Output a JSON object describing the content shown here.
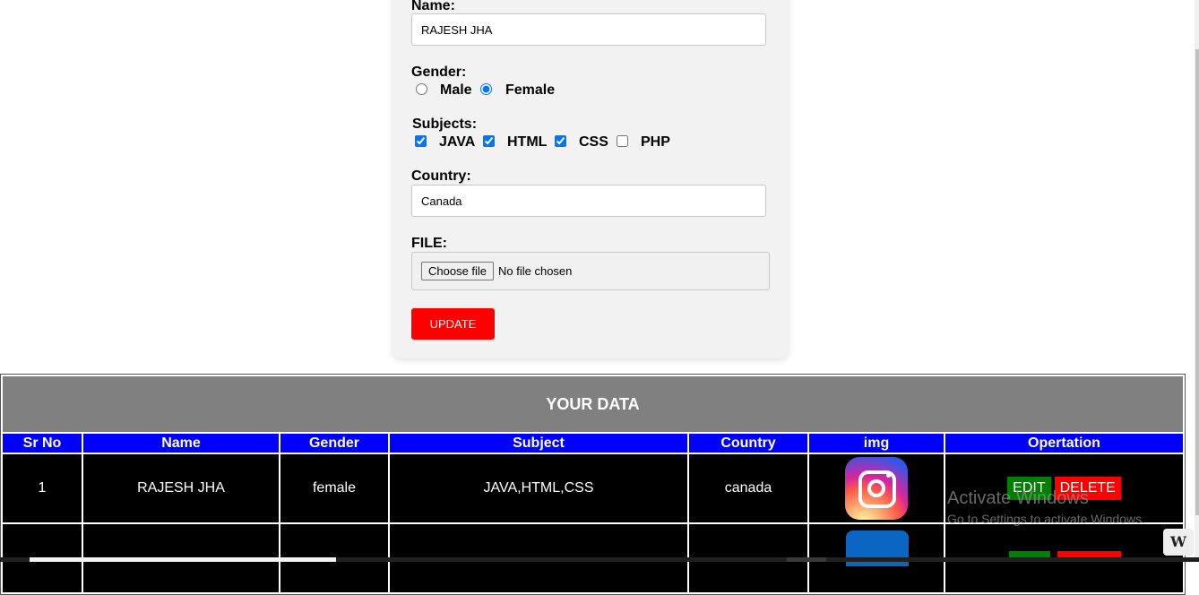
{
  "form": {
    "name_label": "Name:",
    "name_value": "RAJESH JHA",
    "gender_label": "Gender:",
    "gender_options": [
      {
        "label": "Male",
        "checked": false
      },
      {
        "label": "Female",
        "checked": true
      }
    ],
    "subjects_label": "Subjects:",
    "subjects": [
      {
        "label": "JAVA",
        "checked": true
      },
      {
        "label": "HTML",
        "checked": true
      },
      {
        "label": "CSS",
        "checked": true
      },
      {
        "label": "PHP",
        "checked": false
      }
    ],
    "country_label": "Country:",
    "country_value": "Canada",
    "file_label": "FILE:",
    "file_button": "Choose file",
    "file_status": "No file chosen",
    "update_button": "UPDATE"
  },
  "table": {
    "caption": "YOUR DATA",
    "headers": [
      "Sr No",
      "Name",
      "Gender",
      "Subject",
      "Country",
      "img",
      "Opertation"
    ],
    "rows": [
      {
        "sr": "1",
        "name": "RAJESH JHA",
        "gender": "female",
        "subject": "JAVA,HTML,CSS",
        "country": "canada",
        "img_icon": "instagram-icon",
        "edit": "EDIT",
        "delete": "DELETE"
      }
    ],
    "partial_row_icon": "linkedin-icon"
  },
  "watermark": {
    "title": "Activate Windows",
    "subtitle": "Go to Settings to activate Windows."
  },
  "taskbar": {
    "app_icon_letter": "W"
  },
  "colors": {
    "header_blue": "#0000ff",
    "caption_gray": "#808080",
    "update_red": "#ff0000",
    "edit_green": "#008000",
    "delete_red": "#ff0000"
  }
}
